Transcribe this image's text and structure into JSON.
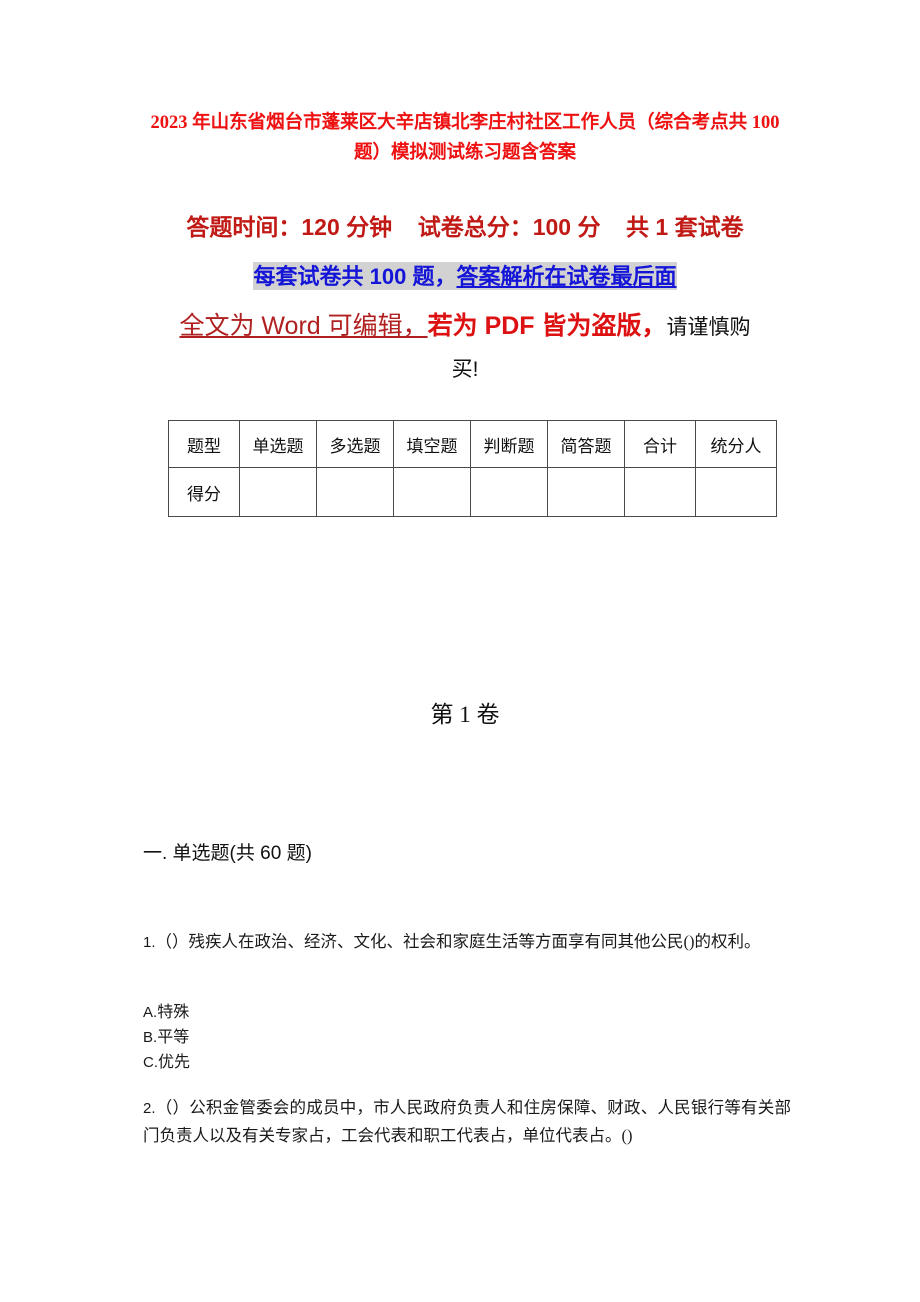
{
  "document": {
    "title": "2023 年山东省烟台市蓬莱区大辛店镇北李庄村社区工作人员（综合考点共 100 题）模拟测试练习题含答案",
    "colors": {
      "title_red": "#ee1111",
      "notice_red": "#c11a16",
      "notice_blue": "#1515d8",
      "highlight_gray": "#d2d2d2",
      "dark_red": "#b02020",
      "bright_red": "#dd1111",
      "text_black": "#111111",
      "table_border": "#4a4a4a"
    }
  },
  "notice": {
    "line1": "答题时间：120 分钟    试卷总分：100 分    共 1 套试卷",
    "line2_plain": "每套试卷共 100 题，",
    "line2_underlined": "答案解析在试卷最后面",
    "line3_word": "全文为 Word 可编辑，",
    "line3_pdf": "若为 PDF 皆为盗版，",
    "line3_caution": "请谨慎购",
    "line4": "买!"
  },
  "score_table": {
    "headers": [
      "题型",
      "单选题",
      "多选题",
      "填空题",
      "判断题",
      "简答题",
      "合计",
      "统分人"
    ],
    "rows": [
      {
        "label": "得分",
        "cells": [
          "",
          "",
          "",
          "",
          "",
          "",
          ""
        ]
      }
    ]
  },
  "volume": {
    "heading": "第 1 卷"
  },
  "section": {
    "heading": "一. 单选题(共 60 题)"
  },
  "questions": [
    {
      "number": "1.",
      "marker": "（）",
      "text": "残疾人在政治、经济、文化、社会和家庭生活等方面享有同其他公民()的权利。",
      "options": [
        {
          "letter": "A.",
          "text": "特殊"
        },
        {
          "letter": "B.",
          "text": "平等"
        },
        {
          "letter": "C.",
          "text": "优先"
        }
      ]
    },
    {
      "number": "2.",
      "marker": "（）",
      "text": "公积金管委会的成员中，市人民政府负责人和住房保障、财政、人民银行等有关部门负责人以及有关专家占，工会代表和职工代表占，单位代表占。()",
      "options": []
    }
  ]
}
